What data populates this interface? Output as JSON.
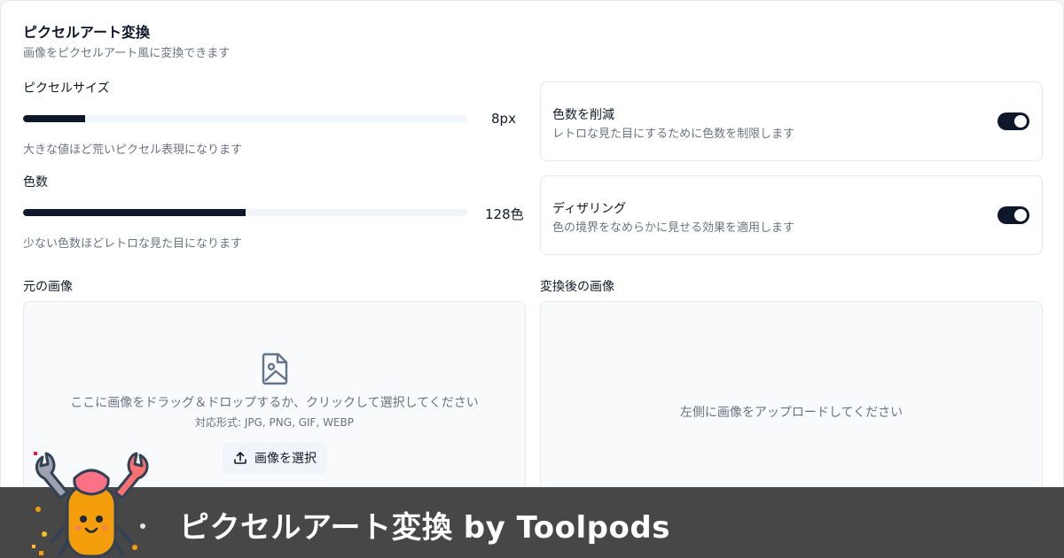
{
  "header": {
    "title": "ピクセルアート変換",
    "subtitle": "画像をピクセルアート風に変換できます"
  },
  "pixel_size": {
    "label": "ピクセルサイズ",
    "value_text": "8px",
    "fill_fraction": 0.14,
    "hint": "大きな値ほど荒いピクセル表現になります"
  },
  "color_count": {
    "label": "色数",
    "value_text": "128色",
    "fill_fraction": 0.5,
    "hint": "少ない色数ほどレトロな見た目になります"
  },
  "reduce_colors": {
    "title": "色数を削減",
    "description": "レトロな見た目にするために色数を制限します",
    "enabled": true
  },
  "dithering": {
    "title": "ディザリング",
    "description": "色の境界をなめらかに見せる効果を適用します",
    "enabled": true
  },
  "source_panel": {
    "label": "元の画像",
    "drop_text": "ここに画像をドラッグ＆ドロップするか、クリックして選択してください",
    "formats": "対応形式: JPG, PNG, GIF, WEBP",
    "select_button": "画像を選択"
  },
  "result_panel": {
    "label": "変換後の画像",
    "placeholder": "左側に画像をアップロードしてください"
  },
  "banner": {
    "text": "ピクセルアート変換 by Toolpods"
  },
  "colors": {
    "accent": "#0f172a",
    "muted_text": "#6b7280",
    "banner_bg": "#474747"
  },
  "icons": {
    "image": "image-file-icon",
    "upload": "upload-icon",
    "mascot": "crab-mascot-logo"
  }
}
